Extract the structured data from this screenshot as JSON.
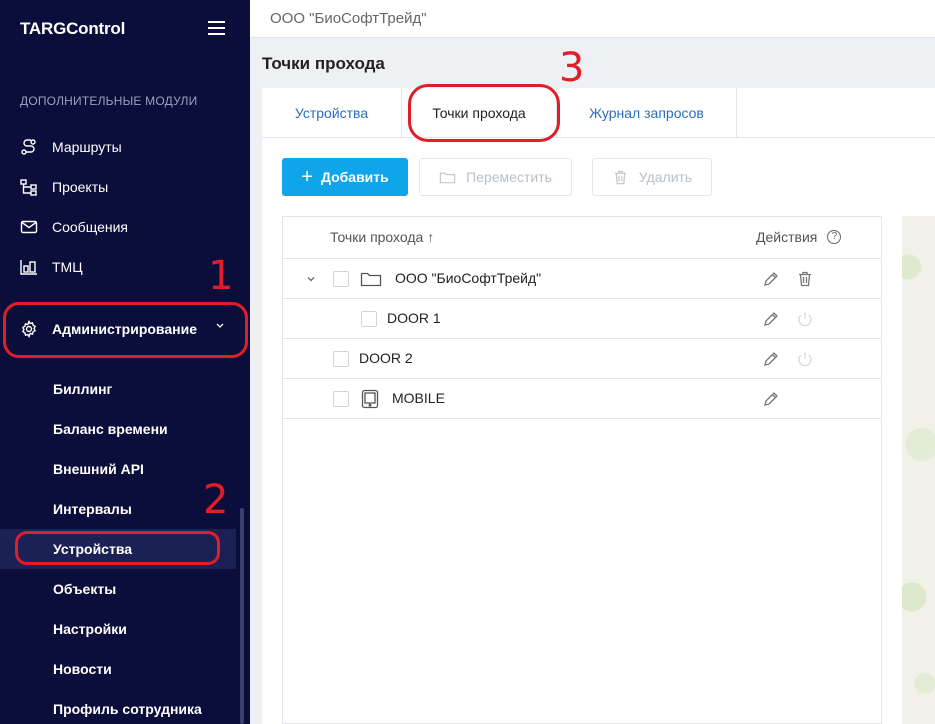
{
  "sidebar": {
    "logo": "TARGControl",
    "section_label": "ДОПОЛНИТЕЛЬНЫЕ МОДУЛИ",
    "items": [
      {
        "label": "Маршруты",
        "icon": "route-icon"
      },
      {
        "label": "Проекты",
        "icon": "projects-icon"
      },
      {
        "label": "Сообщения",
        "icon": "mail-icon"
      },
      {
        "label": "ТМЦ",
        "icon": "inventory-icon"
      }
    ],
    "admin": {
      "label": "Администрирование",
      "icon": "gear-icon"
    },
    "sub_items": [
      "Биллинг",
      "Баланс времени",
      "Внешний API",
      "Интервалы",
      "Устройства",
      "Объекты",
      "Настройки",
      "Новости",
      "Профиль сотрудника"
    ],
    "active_sub_item": "Устройства"
  },
  "topbar": {
    "org_name": "ООО \"БиоСофтТрейд\""
  },
  "page": {
    "title": "Точки прохода"
  },
  "tabs": [
    {
      "label": "Устройства",
      "active": false
    },
    {
      "label": "Точки прохода",
      "active": true
    },
    {
      "label": "Журнал запросов",
      "active": false
    }
  ],
  "toolbar": {
    "add_label": "Добавить",
    "move_label": "Переместить",
    "delete_label": "Удалить"
  },
  "table": {
    "columns": {
      "name": "Точки прохода ↑",
      "actions": "Действия",
      "help": "?"
    },
    "rows": [
      {
        "label": "ООО \"БиоСофтТрейд\"",
        "type": "folder",
        "level": 0,
        "expanded": true,
        "actions": [
          "edit",
          "delete"
        ]
      },
      {
        "label": "DOOR 1",
        "type": "door",
        "level": 1,
        "actions": [
          "edit",
          "power"
        ]
      },
      {
        "label": "DOOR 2",
        "type": "door",
        "level": 0,
        "actions": [
          "edit",
          "power"
        ]
      },
      {
        "label": "MOBILE",
        "type": "mobile",
        "level": 0,
        "actions": [
          "edit"
        ]
      }
    ]
  },
  "annotations": {
    "one": "1",
    "two": "2",
    "three": "3"
  },
  "colors": {
    "sidebar_bg": "#0b0e3a",
    "accent": "#0ea5e9",
    "link": "#2a6ebb",
    "annotation": "#e11d2a"
  }
}
